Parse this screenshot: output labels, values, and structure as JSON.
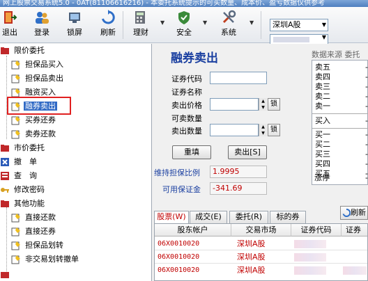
{
  "window": {
    "title": "网上股票交易系统5.0 - 0AT(81106616216) - 本委托系统提示的可买数量、成本价、盈亏数据仅供参考"
  },
  "toolbar": {
    "buttons": [
      {
        "label": "退出",
        "icon": "exit-icon"
      },
      {
        "label": "登录",
        "icon": "users-icon"
      },
      {
        "label": "锁屏",
        "icon": "lock-icon"
      },
      {
        "label": "刷新",
        "icon": "refresh-icon"
      },
      {
        "label": "理财",
        "icon": "calculator-icon"
      },
      {
        "label": "安全",
        "icon": "shield-icon"
      },
      {
        "label": "系统",
        "icon": "tools-icon"
      }
    ],
    "market_select": "深圳A股"
  },
  "tree": {
    "items": [
      {
        "label": "限价委托",
        "icon": "folder-icon",
        "level": 0
      },
      {
        "label": "担保品买入",
        "icon": "form-icon",
        "level": 1
      },
      {
        "label": "担保品卖出",
        "icon": "form-icon",
        "level": 1
      },
      {
        "label": "融资买入",
        "icon": "form-icon",
        "level": 1
      },
      {
        "label": "融券卖出",
        "icon": "form-icon",
        "level": 1,
        "selected": true
      },
      {
        "label": "买券还券",
        "icon": "form-icon",
        "level": 1
      },
      {
        "label": "卖券还款",
        "icon": "form-icon",
        "level": 1
      },
      {
        "label": "市价委托",
        "icon": "folder-icon",
        "level": 0
      },
      {
        "label": "撤　单",
        "icon": "undo-icon",
        "level": 0
      },
      {
        "label": "查　询",
        "icon": "query-icon",
        "level": 0
      },
      {
        "label": "修改密码",
        "icon": "key-icon",
        "level": 0
      },
      {
        "label": "其他功能",
        "icon": "folder-icon",
        "level": 0
      },
      {
        "label": "直接还款",
        "icon": "form-icon",
        "level": 1
      },
      {
        "label": "直接还券",
        "icon": "form-icon",
        "level": 1
      },
      {
        "label": "担保品划转",
        "icon": "form-icon",
        "level": 1
      },
      {
        "label": "非交易划转撤单",
        "icon": "form-icon",
        "level": 1
      }
    ]
  },
  "form": {
    "title": "融券卖出",
    "labels": {
      "code": "证券代码",
      "name": "证券名称",
      "price": "卖出价格",
      "avail": "可卖数量",
      "qty": "卖出数量"
    },
    "lock_label": "锁",
    "reset_label": "重填",
    "sell_label": "卖出[S]",
    "margin_ratio_label": "维持担保比例",
    "margin_ratio_value": "1.9995",
    "avail_deposit_label": "可用保证金",
    "avail_deposit_value": "-341.69"
  },
  "quote": {
    "header": "数据来源  委托",
    "sell": [
      "卖五",
      "卖四",
      "卖三",
      "卖二",
      "卖一"
    ],
    "buy_header": "买入",
    "buy": [
      "买一",
      "买二",
      "买三",
      "买四",
      "买五"
    ],
    "limit_up": "涨停",
    "dash": "-"
  },
  "tabs": [
    {
      "label": "股票(W)",
      "active": true
    },
    {
      "label": "成交(E)",
      "active": false
    },
    {
      "label": "委托(R)",
      "active": false
    },
    {
      "label": "标的券",
      "active": false
    }
  ],
  "refresh_label": "刷新",
  "table": {
    "columns": [
      "股东帐户",
      "交易市场",
      "证券代码",
      "证券"
    ],
    "rows": [
      {
        "account": "06X0010020",
        "market": "深圳A股"
      },
      {
        "account": "06X0010020",
        "market": "深圳A股"
      },
      {
        "account": "06X0010020",
        "market": "深圳A股"
      }
    ]
  },
  "colors": {
    "accent": "#1a3fa0",
    "selected": "#316ac5",
    "negative": "#c00000",
    "highlight": "#e02020"
  }
}
